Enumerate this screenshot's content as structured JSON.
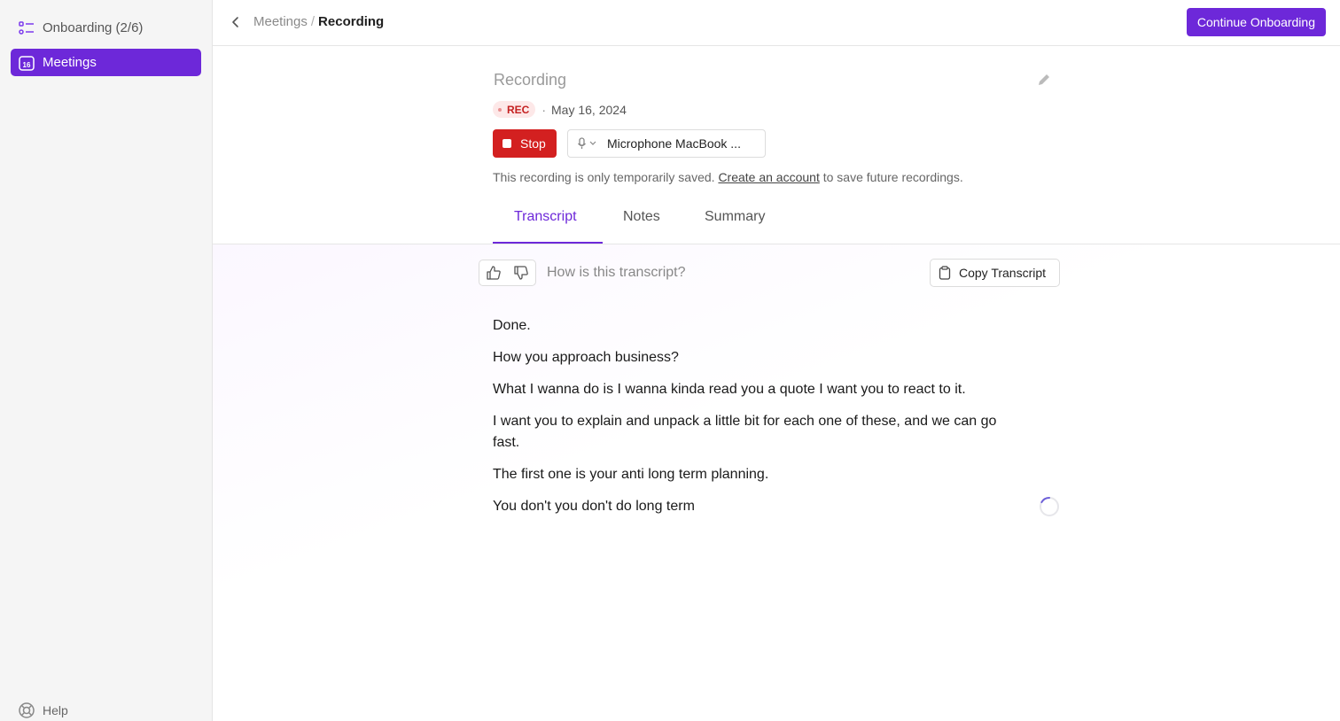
{
  "sidebar": {
    "items": [
      {
        "label": "Onboarding (2/6)",
        "icon": "checklist-icon"
      },
      {
        "label": "Meetings",
        "icon": "calendar-icon",
        "badge": "16"
      }
    ],
    "help_label": "Help",
    "accent": "#6d28d9"
  },
  "header": {
    "breadcrumb_parent": "Meetings",
    "breadcrumb_separator": "/",
    "breadcrumb_current": "Recording",
    "continue_label": "Continue Onboarding"
  },
  "recording": {
    "title": "Recording",
    "rec_label": "REC",
    "bullet": "·",
    "date": "May 16, 2024",
    "stop_label": "Stop",
    "microphone_value": "Microphone MacBook ...",
    "note_prefix": "This recording is only temporarily saved.",
    "note_link": "Create an account",
    "note_suffix": "to save future recordings."
  },
  "tabs": [
    {
      "label": "Transcript",
      "active": true
    },
    {
      "label": "Notes",
      "active": false
    },
    {
      "label": "Summary",
      "active": false
    }
  ],
  "transcript": {
    "feedback_question": "How is this transcript?",
    "copy_label": "Copy Transcript",
    "lines": [
      "Done.",
      "How you approach business?",
      "What I wanna do is I wanna kinda read you a quote I want you to react to it.",
      "I want you to explain and unpack a little bit for each one of these, and we can go fast.",
      "The first one is your anti long term planning.",
      "You don't you don't do long term"
    ]
  }
}
